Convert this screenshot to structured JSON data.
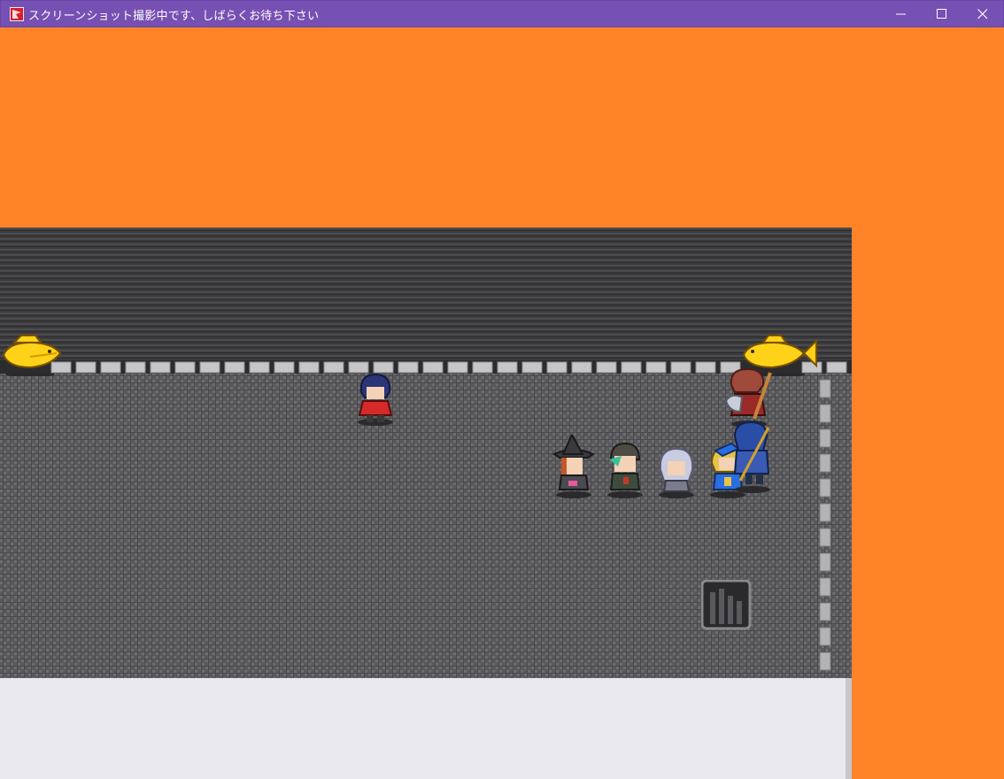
{
  "window": {
    "title": "スクリーンショット撮影中です、しばらくお待ち下さい",
    "app_icon": "app-icon",
    "controls": [
      "minimize-icon",
      "maximize-icon",
      "close-icon"
    ]
  },
  "colors": {
    "titlebar": "#7650b2",
    "background": "#ff8327",
    "floor": "#5e5e61",
    "wall": "#3b3b3d",
    "message_window": "#e9e9ee"
  },
  "scene": {
    "npc": "npc-red-jacket",
    "party": [
      "party-witch",
      "party-green-hair",
      "party-silver-hair",
      "party-blonde-blue-cap"
    ],
    "guards": [
      "guard-axe",
      "guard-spear"
    ],
    "objects": [
      "fish-statue-left",
      "fish-statue-right",
      "floor-grate"
    ]
  }
}
